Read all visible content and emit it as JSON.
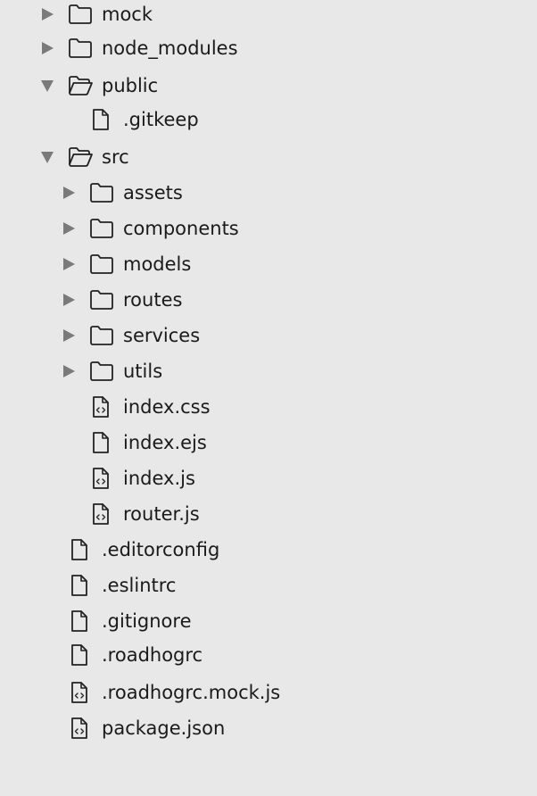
{
  "tree": [
    {
      "label": "mock",
      "kind": "folder",
      "depth": 0,
      "state": "collapsed"
    },
    {
      "label": "node_modules",
      "kind": "folder",
      "depth": 0,
      "state": "collapsed"
    },
    {
      "label": "public",
      "kind": "folder",
      "depth": 0,
      "state": "expanded"
    },
    {
      "label": ".gitkeep",
      "kind": "file",
      "depth": 1
    },
    {
      "label": "src",
      "kind": "folder",
      "depth": 0,
      "state": "expanded"
    },
    {
      "label": "assets",
      "kind": "folder",
      "depth": 1,
      "state": "collapsed"
    },
    {
      "label": "components",
      "kind": "folder",
      "depth": 1,
      "state": "collapsed"
    },
    {
      "label": "models",
      "kind": "folder",
      "depth": 1,
      "state": "collapsed"
    },
    {
      "label": "routes",
      "kind": "folder",
      "depth": 1,
      "state": "collapsed"
    },
    {
      "label": "services",
      "kind": "folder",
      "depth": 1,
      "state": "collapsed"
    },
    {
      "label": "utils",
      "kind": "folder",
      "depth": 1,
      "state": "collapsed"
    },
    {
      "label": "index.css",
      "kind": "code-file",
      "depth": 1
    },
    {
      "label": "index.ejs",
      "kind": "file",
      "depth": 1
    },
    {
      "label": "index.js",
      "kind": "code-file",
      "depth": 1
    },
    {
      "label": "router.js",
      "kind": "code-file",
      "depth": 1
    },
    {
      "label": ".editorconfig",
      "kind": "file",
      "depth": 0
    },
    {
      "label": ".eslintrc",
      "kind": "file",
      "depth": 0
    },
    {
      "label": ".gitignore",
      "kind": "file",
      "depth": 0
    },
    {
      "label": ".roadhogrc",
      "kind": "file",
      "depth": 0
    },
    {
      "label": ".roadhogrc.mock.js",
      "kind": "code-file",
      "depth": 0
    },
    {
      "label": "package.json",
      "kind": "code-file",
      "depth": 0
    }
  ],
  "colors": {
    "background": "#e8e8e8",
    "text": "#1a1a1a",
    "icon_stroke": "#222222",
    "arrow": "#7a7a7a"
  }
}
